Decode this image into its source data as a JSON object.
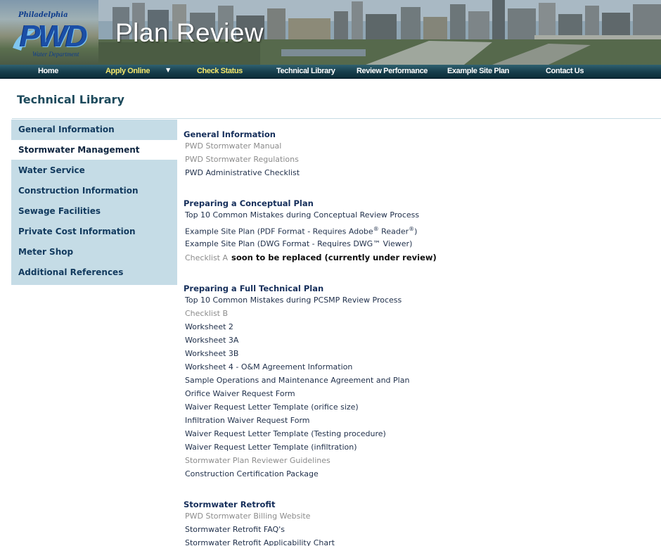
{
  "brand": {
    "city": "Philadelphia",
    "abbr": "PWD",
    "department": "Water Department",
    "site_title": "Plan Review"
  },
  "nav": {
    "items": [
      {
        "label": "Home",
        "active": false
      },
      {
        "label": "Apply Online",
        "active": true,
        "has_dropdown": true
      },
      {
        "label": "Check Status",
        "active": true
      },
      {
        "label": "Technical Library",
        "active": false
      },
      {
        "label": "Review Performance",
        "active": false
      },
      {
        "label": "Example Site Plan",
        "active": false
      },
      {
        "label": "Contact Us",
        "active": false
      }
    ],
    "dropdown_icon": "triangle-down"
  },
  "page": {
    "title": "Technical Library"
  },
  "sidebar": {
    "items": [
      {
        "label": "General Information",
        "selected": false
      },
      {
        "label": "Stormwater Management",
        "selected": true
      },
      {
        "label": "Water Service",
        "selected": false
      },
      {
        "label": "Construction Information",
        "selected": false
      },
      {
        "label": "Sewage Facilities",
        "selected": false
      },
      {
        "label": "Private Cost Information",
        "selected": false
      },
      {
        "label": "Meter Shop",
        "selected": false
      },
      {
        "label": "Additional References",
        "selected": false
      }
    ]
  },
  "sections": [
    {
      "heading": "General Information",
      "links": [
        {
          "text": "PWD Stormwater Manual",
          "muted": true
        },
        {
          "text": "PWD Stormwater Regulations",
          "muted": true
        },
        {
          "text": "PWD Administrative Checklist",
          "muted": false
        }
      ]
    },
    {
      "heading": "Preparing a Conceptual Plan",
      "links": [
        {
          "text": "Top 10 Common Mistakes during Conceptual Review Process",
          "muted": false
        },
        {
          "text": "Example Site Plan (PDF Format - Requires Adobe",
          "sup1": "®",
          "mid": " Reader",
          "sup2": "®",
          "end": ")",
          "muted": false
        },
        {
          "text": "Example Site Plan (DWG Format - Requires DWG™ Viewer)",
          "muted": false
        },
        {
          "text": "Checklist A",
          "note": "soon to be replaced (currently under review)",
          "muted": true
        }
      ]
    },
    {
      "heading": "Preparing a Full Technical Plan",
      "links": [
        {
          "text": "Top 10 Common Mistakes during PCSMP Review Process",
          "muted": false
        },
        {
          "text": "Checklist B",
          "muted": true
        },
        {
          "text": "Worksheet 2",
          "muted": false
        },
        {
          "text": "Worksheet 3A",
          "muted": false
        },
        {
          "text": "Worksheet 3B",
          "muted": false
        },
        {
          "text": "Worksheet 4 - O&M Agreement Information",
          "muted": false
        },
        {
          "text": "Sample Operations and Maintenance Agreement and Plan",
          "muted": false
        },
        {
          "text": "Orifice Waiver Request Form",
          "muted": false
        },
        {
          "text": "Waiver Request Letter Template (orifice size)",
          "muted": false
        },
        {
          "text": "Infiltration Waiver Request Form",
          "muted": false
        },
        {
          "text": "Waiver Request Letter Template (Testing procedure)",
          "muted": false
        },
        {
          "text": "Waiver Request Letter Template (infiltration)",
          "muted": false
        },
        {
          "text": "Stormwater Plan Reviewer Guidelines",
          "muted": true
        },
        {
          "text": "Construction Certification Package",
          "muted": false
        }
      ]
    },
    {
      "heading": "Stormwater Retrofit",
      "links": [
        {
          "text": "PWD Stormwater Billing Website",
          "muted": true
        },
        {
          "text": "Stormwater Retrofit FAQ's",
          "muted": false
        },
        {
          "text": "Stormwater Retrofit Applicability Chart",
          "muted": false
        }
      ]
    }
  ],
  "colors": {
    "nav_active": "#f4e76a",
    "heading": "#1d4a5c",
    "sidebar_bg": "#c5dce6",
    "link": "#1f2f4a",
    "muted_link": "#8c8c8c"
  }
}
